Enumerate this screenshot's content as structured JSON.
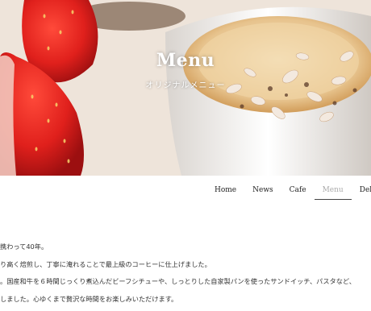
{
  "hero": {
    "title": "Menu",
    "subtitle": "オリジナルメニュー"
  },
  "nav": {
    "items": [
      "Home",
      "News",
      "Cafe",
      "Menu",
      "Delive"
    ],
    "active": "Menu"
  },
  "body": {
    "lines": [
      "携わって40年。",
      "り高く焙煎し、丁寧に淹れることで最上級のコーヒーに仕上げました。",
      "。国産和牛を６時間じっくり煮込んだビーフシチューや、しっとりした自家製パンを使ったサンドイッチ、パスタなど、",
      "しました。心ゆくまで贅沢な時間をお楽しみいただけます。"
    ]
  },
  "colors": {
    "accent_underline": "#444444",
    "inactive_nav": "#aaaaaa"
  }
}
